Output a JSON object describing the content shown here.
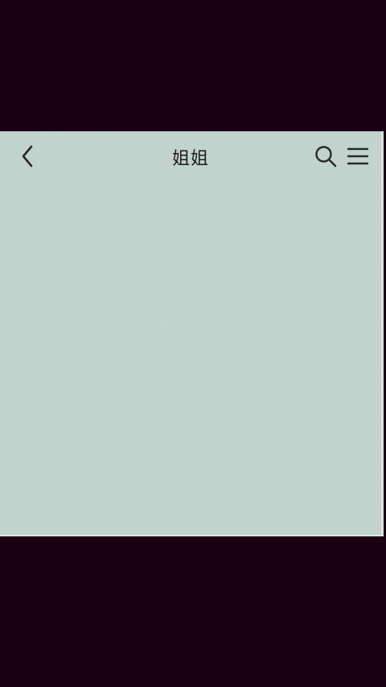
{
  "header": {
    "title": "姐姐",
    "back_icon": "chevron-left-icon",
    "search_icon": "search-icon",
    "menu_icon": "hamburger-menu-icon"
  },
  "colors": {
    "outer_background": "#1a0010",
    "chat_background": "#c0d3cc",
    "icon_color": "#2a2a2a"
  }
}
